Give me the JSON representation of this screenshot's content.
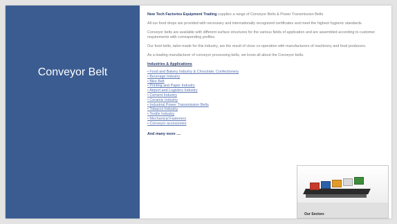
{
  "slide": {
    "title": "Conveyor Belt",
    "intro_company": "New Tech Factories Equipment Trading",
    "intro_rest": " supplies a range of Conveyor Belts & Power Transmission Belts",
    "para2": "All our food drops are provided with necessary and internationally recognized certificates and meet the highest hygienic standards.",
    "para3": "Conveyor belts are available with different surface structures for the various fields of application and are assembled according to customer requirements with corresponding profiles.",
    "para4": "Our food belts, tailor-made for this industry, are the result of close co-operation with manufacturers of machinery and food producers.",
    "para5": "As a leading manufacturer of conveyor processing belts, we know all about the  Conveyor belts.",
    "industries_heading": "Industries & Applications",
    "industries": [
      "Food and Bakery Industry & Chocolate, Confectionery",
      "Beverage Industry",
      "Bike Belt",
      " Printing and Paper Industry",
      "Airport and Logistics Industry",
      "Cement Industry",
      "Ceramic Industry",
      "Industrial Power Transmission Belts",
      "Tobacco Industry",
      "Textile Industry",
      "Mechanical Fasteners",
      "Conveyor accessories"
    ],
    "more": "And many more ....",
    "thumbnail_caption": "Our Sectors"
  },
  "colors": {
    "panel_blue": "#3b5c91",
    "link_blue": "#5a76b3",
    "heading_navy": "#2b3d6b"
  }
}
